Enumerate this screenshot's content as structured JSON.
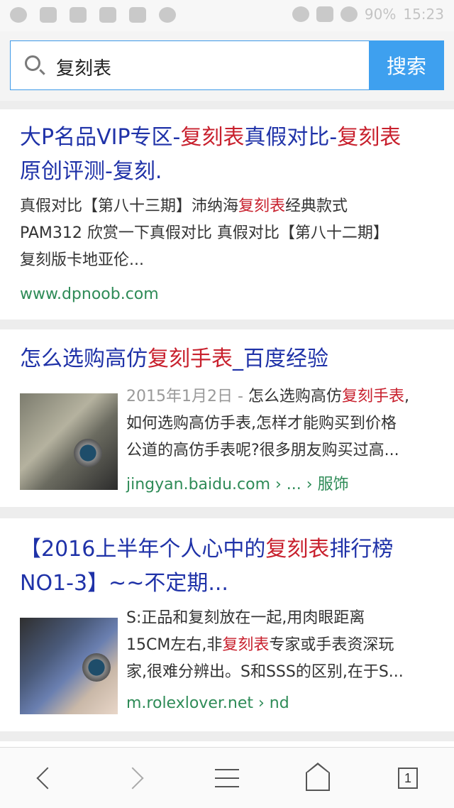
{
  "status_bar": {
    "battery": "90%",
    "time": "15:23"
  },
  "search": {
    "query": "复刻表",
    "button_label": "搜索"
  },
  "results": [
    {
      "title_parts": [
        "大P名品VIP专区-",
        "复刻表",
        "真假对比-",
        "复刻表",
        "原创评测-复刻."
      ],
      "desc_lines": [
        [
          "真假对比【第八十三期】沛纳海",
          "复刻表",
          "经典款式"
        ],
        [
          "PAM312 欣赏一下真假对比 真假对比【第八十二期】"
        ],
        [
          "复刻版卡地亚伦..."
        ]
      ],
      "url": "www.dpnoob.com"
    },
    {
      "title_parts": [
        "怎么选购高仿",
        "复刻手表",
        "_百度经验"
      ],
      "date": "2015年1月2日 -",
      "desc_lines": [
        [
          "怎么选购高仿",
          "复刻手表",
          ","
        ],
        [
          "如何选购高仿手表,怎样才能购买到价格"
        ],
        [
          "公道的高仿手表呢?很多朋友购买过高..."
        ]
      ],
      "url": "jingyan.baidu.com › ... › 服饰"
    },
    {
      "title_parts": [
        "【2016上半年个人心中的",
        "复刻表",
        "排行榜",
        "NO1-3】~~不定期..."
      ],
      "desc_lines": [
        [
          "S:正品和复刻放在一起,用肉眼距离"
        ],
        [
          "15CM左右,非",
          "复刻表",
          "专家或手表资深玩"
        ],
        [
          "家,很难分辨出。S和SSS的区别,在于S..."
        ]
      ],
      "url": "m.rolexlover.net › nd"
    }
  ],
  "bottom_nav": {
    "tab_count": "1"
  },
  "colors": {
    "link_blue": "#1f32a8",
    "highlight_red": "#c8202d",
    "url_green": "#2e8b57",
    "search_blue": "#3ea0ef"
  }
}
